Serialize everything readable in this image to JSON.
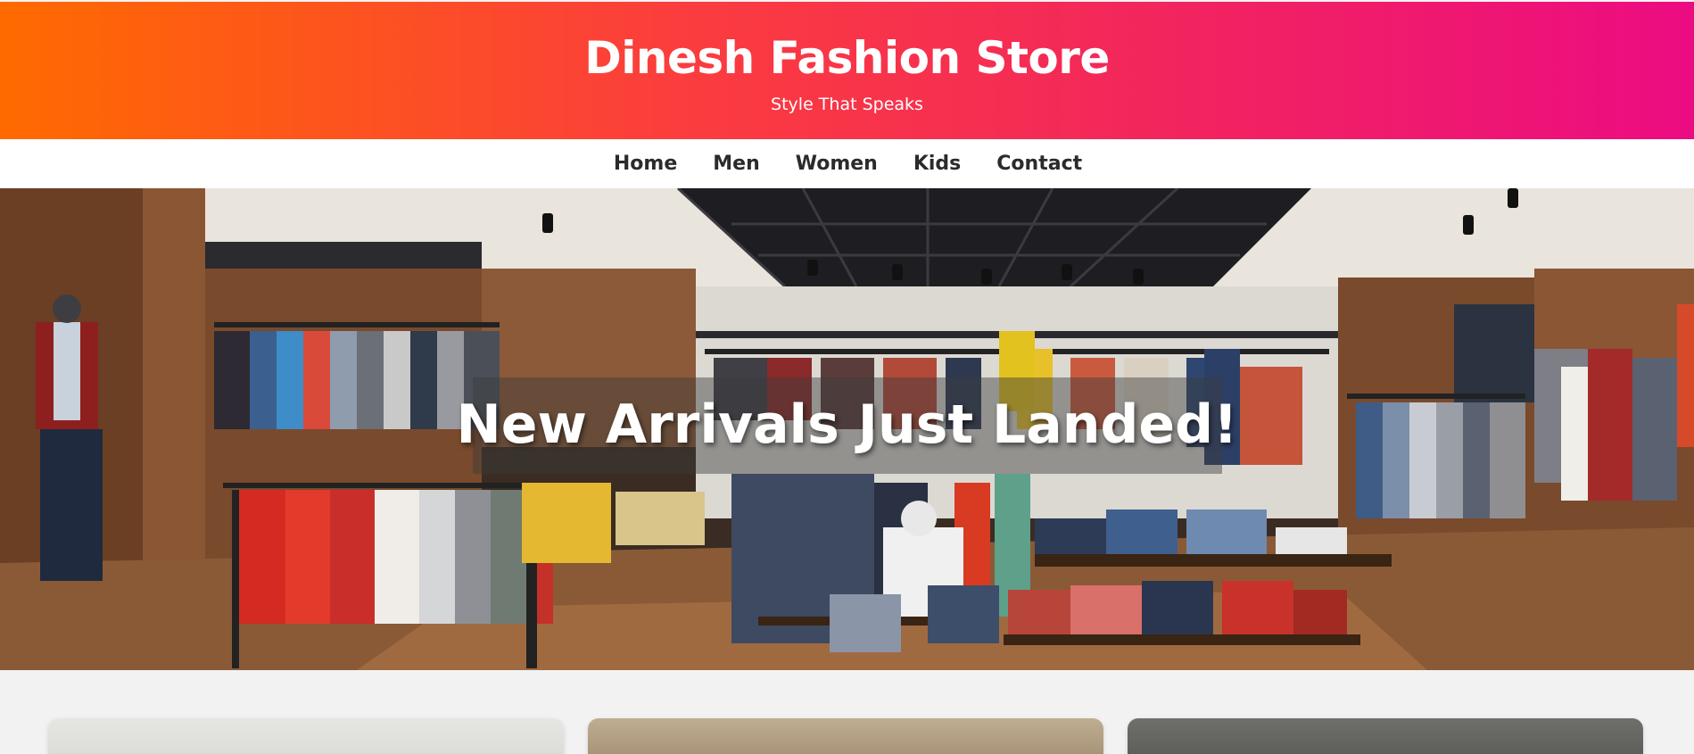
{
  "header": {
    "title": "Dinesh Fashion Store",
    "tagline": "Style That Speaks",
    "gradient": [
      "#ff6a00",
      "#ec0c82"
    ]
  },
  "nav": {
    "items": [
      {
        "label": "Home"
      },
      {
        "label": "Men"
      },
      {
        "label": "Women"
      },
      {
        "label": "Kids"
      },
      {
        "label": "Contact"
      }
    ]
  },
  "hero": {
    "heading": "New Arrivals Just Landed!",
    "image_icon": "clothing-store-photo"
  },
  "categories": {
    "cards": [
      {
        "icon": "category-card-image"
      },
      {
        "icon": "category-card-image"
      },
      {
        "icon": "category-card-image"
      }
    ]
  }
}
